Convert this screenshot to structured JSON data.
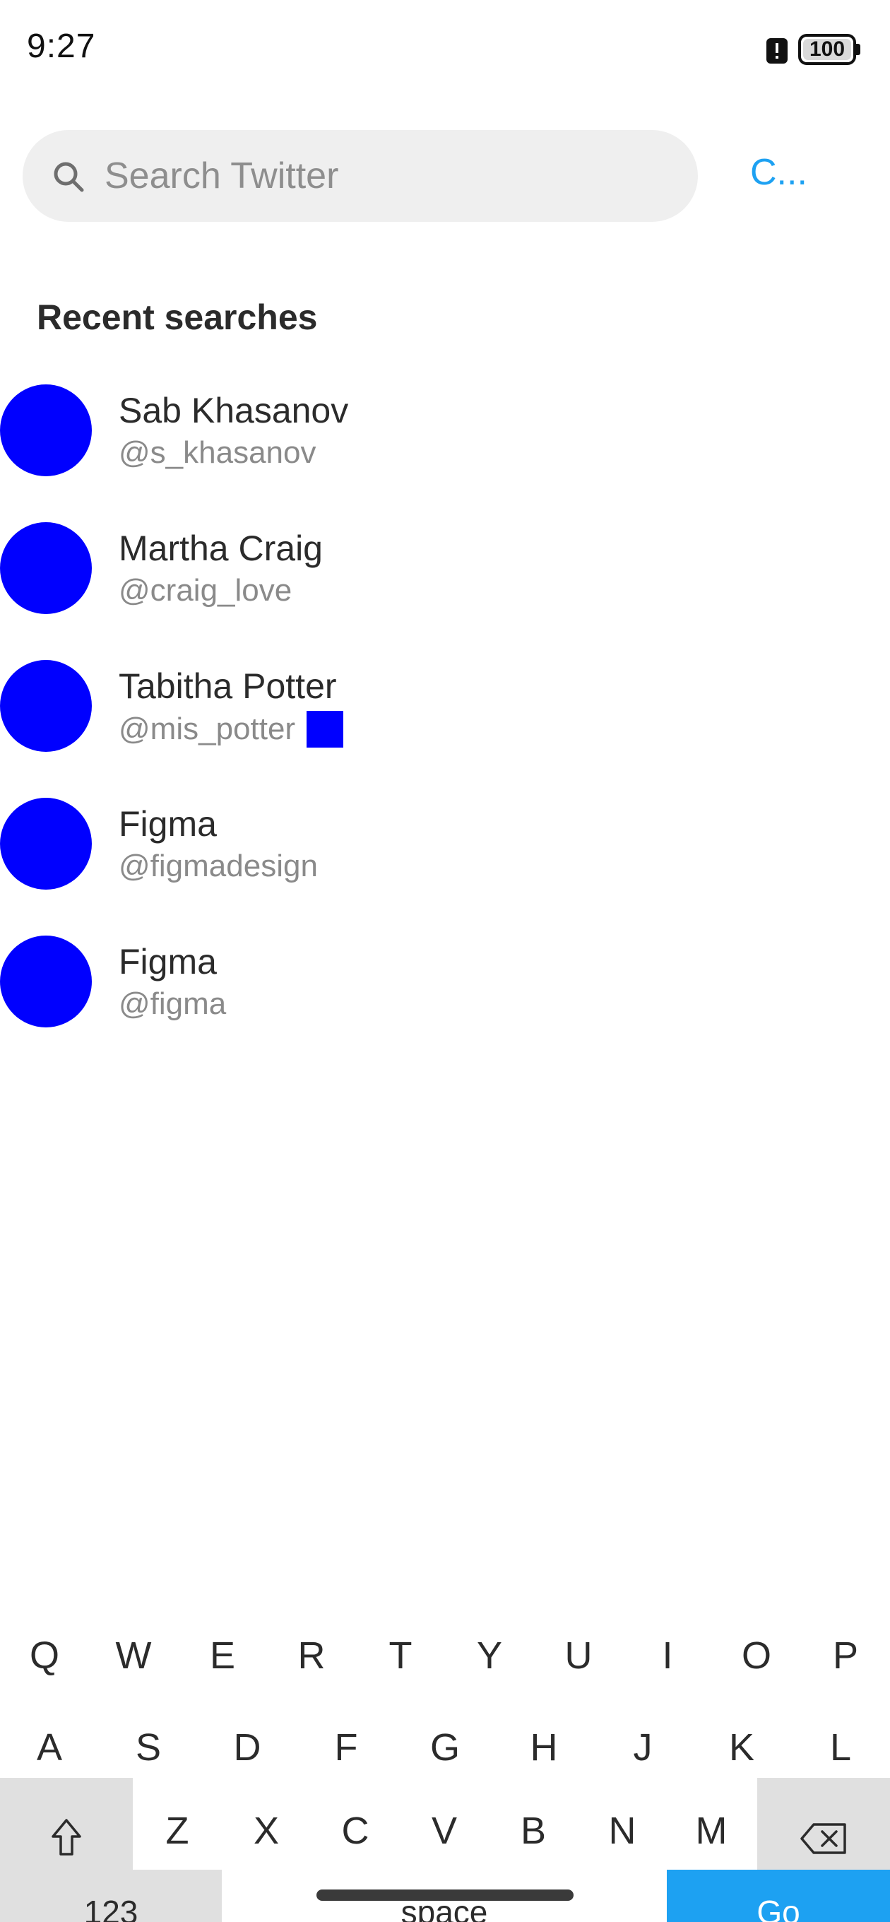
{
  "status_bar": {
    "time": "9:27",
    "battery": "100",
    "alert_icon": "alert-icon"
  },
  "search": {
    "placeholder": "Search Twitter",
    "value": "",
    "icon": "search-icon",
    "cancel_label": "C..."
  },
  "recent": {
    "title": "Recent searches",
    "items": [
      {
        "name": "Sab Khasanov",
        "handle": "@s_khasanov",
        "verified": false
      },
      {
        "name": "Martha Craig",
        "handle": "@craig_love",
        "verified": false
      },
      {
        "name": "Tabitha Potter",
        "handle": "@mis_potter",
        "verified": true
      },
      {
        "name": "Figma",
        "handle": "@figmadesign",
        "verified": false
      },
      {
        "name": "Figma",
        "handle": "@figma",
        "verified": false
      }
    ]
  },
  "keyboard": {
    "row1": [
      "Q",
      "W",
      "E",
      "R",
      "T",
      "Y",
      "U",
      "I",
      "O",
      "P"
    ],
    "row2": [
      "A",
      "S",
      "D",
      "F",
      "G",
      "H",
      "J",
      "K",
      "L"
    ],
    "row3": [
      "Z",
      "X",
      "C",
      "V",
      "B",
      "N",
      "M"
    ],
    "shift_icon": "shift-icon",
    "backspace_icon": "backspace-icon",
    "numbers_label": "123",
    "space_label": "space",
    "go_label": "Go"
  },
  "colors": {
    "accent": "#1da1f2",
    "avatar_placeholder": "#0000ff",
    "search_bg": "#efefef"
  }
}
